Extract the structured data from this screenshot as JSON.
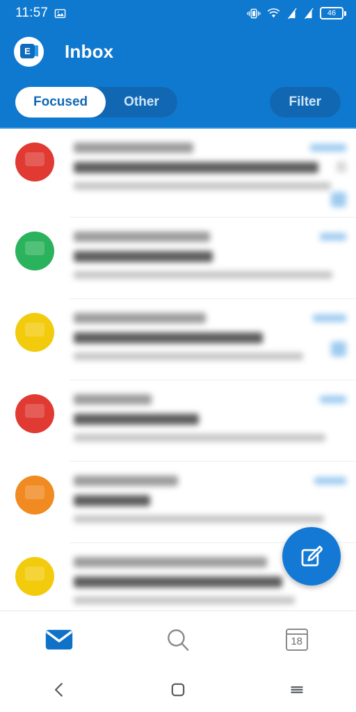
{
  "status_bar": {
    "time": "11:57",
    "icons": [
      "image-notification-icon",
      "vibrate-icon",
      "wifi-icon",
      "signal-off-icon",
      "signal-off-icon-2"
    ],
    "battery_level": "46"
  },
  "header": {
    "account_icon": "exchange-account-icon",
    "account_initial": "E",
    "title": "Inbox",
    "background_color": "#0F79D0"
  },
  "tabs": {
    "items": [
      {
        "label": "Focused",
        "active": true
      },
      {
        "label": "Other",
        "active": false
      }
    ],
    "filter_label": "Filter"
  },
  "message_list": {
    "redacted": true,
    "rows": [
      {
        "avatar_color": "#E03A32",
        "sender_w": 172,
        "subject_w": 352,
        "preview_w": 370,
        "time_w": 52,
        "has_blue_badge": true,
        "has_gray_badge": true
      },
      {
        "avatar_color": "#2BB25C",
        "sender_w": 196,
        "subject_w": 200,
        "preview_w": 372,
        "time_w": 38,
        "has_blue_badge": false,
        "has_gray_badge": false
      },
      {
        "avatar_color": "#F2CB0D",
        "sender_w": 190,
        "subject_w": 272,
        "preview_w": 330,
        "time_w": 48,
        "has_blue_badge": true,
        "has_gray_badge": false
      },
      {
        "avatar_color": "#E03A32",
        "sender_w": 112,
        "subject_w": 180,
        "preview_w": 362,
        "time_w": 38,
        "has_blue_badge": false,
        "has_gray_badge": false
      },
      {
        "avatar_color": "#F18A21",
        "sender_w": 150,
        "subject_w": 110,
        "preview_w": 360,
        "time_w": 46,
        "has_blue_badge": false,
        "has_gray_badge": false
      },
      {
        "avatar_color": "#F2CB0D",
        "sender_w": 278,
        "subject_w": 300,
        "preview_w": 318,
        "time_w": 0,
        "has_blue_badge": false,
        "has_gray_badge": false
      }
    ]
  },
  "compose_fab": {
    "icon": "compose-icon",
    "color": "#1379D4"
  },
  "bottom_nav": {
    "items": [
      {
        "icon": "mail-icon",
        "active": true
      },
      {
        "icon": "search-icon",
        "active": false
      },
      {
        "icon": "calendar-icon",
        "active": false
      }
    ],
    "calendar_day": "18"
  },
  "system_nav": {
    "items": [
      {
        "icon": "back-icon"
      },
      {
        "icon": "home-icon"
      },
      {
        "icon": "recents-icon"
      }
    ]
  }
}
